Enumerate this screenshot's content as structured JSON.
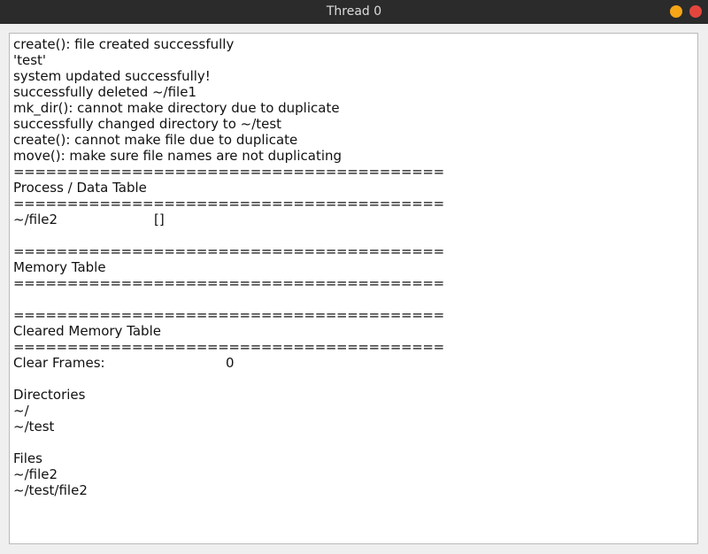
{
  "window": {
    "title": "Thread 0",
    "minimize_color": "#f5a516",
    "close_color": "#e4463e"
  },
  "log": [
    "create(): file created successfully",
    "'test'",
    "system updated successfully!",
    "successfully deleted ~/file1",
    "mk_dir(): cannot make directory due to duplicate",
    "successfully changed directory to ~/test",
    "create(): cannot make file due to duplicate",
    "move(): make sure file names are not duplicating"
  ],
  "separator": "========================================",
  "process_table": {
    "title": "Process / Data Table",
    "rows": [
      {
        "name": "~/file2",
        "data": "[]"
      }
    ]
  },
  "memory_table": {
    "title": "Memory Table"
  },
  "cleared_memory_table": {
    "title": "Cleared Memory Table",
    "clear_frames_label": "Clear Frames:",
    "clear_frames_value": "0"
  },
  "directories": {
    "title": "Directories",
    "items": [
      "~/",
      "~/test"
    ]
  },
  "files": {
    "title": "Files",
    "items": [
      "~/file2",
      "~/test/file2"
    ]
  }
}
